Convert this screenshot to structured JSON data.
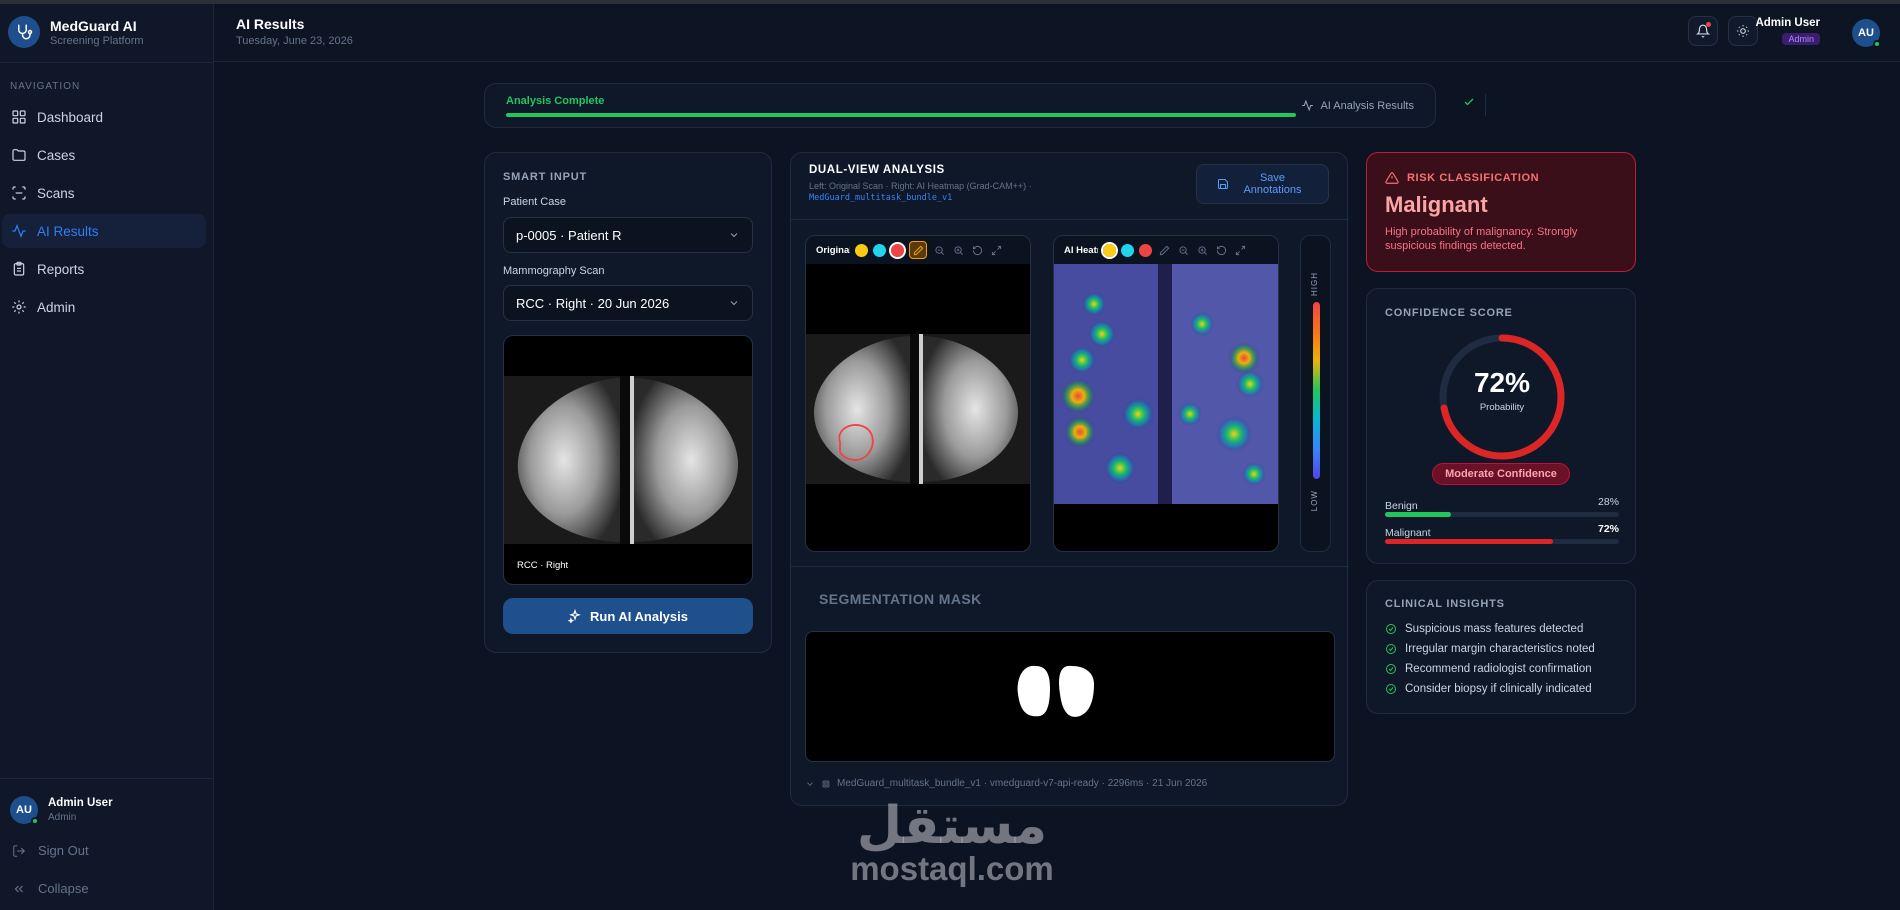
{
  "sidebar": {
    "brand_title": "MedGuard AI",
    "brand_subtitle": "Screening Platform",
    "nav_heading": "NAVIGATION",
    "items": [
      {
        "label": "Dashboard",
        "icon": "grid-icon",
        "active": false
      },
      {
        "label": "Cases",
        "icon": "folder-icon",
        "active": false
      },
      {
        "label": "Scans",
        "icon": "scan-icon",
        "active": false
      },
      {
        "label": "AI Results",
        "icon": "activity-icon",
        "active": true
      },
      {
        "label": "Reports",
        "icon": "clipboard-icon",
        "active": false
      },
      {
        "label": "Admin",
        "icon": "gear-icon",
        "active": false
      }
    ],
    "user_initials": "AU",
    "user_name": "Admin User",
    "user_role": "Admin",
    "sign_out": "Sign Out",
    "collapse": "Collapse"
  },
  "header": {
    "title": "AI Results",
    "date": "Tuesday, June 23, 2026",
    "user_name": "Admin User",
    "user_badge": "Admin",
    "user_initials": "AU"
  },
  "progress": {
    "label": "Analysis Complete",
    "percent": 100,
    "right_label": "AI Analysis Results"
  },
  "smart_input": {
    "title": "SMART INPUT",
    "patient_label": "Patient Case",
    "patient_value": "p-0005 · Patient R",
    "scan_label": "Mammography Scan",
    "scan_value": "RCC · Right · 20 Jun 2026",
    "thumb_caption": "RCC · Right",
    "run_button": "Run AI Analysis"
  },
  "dual_view": {
    "title": "DUAL-VIEW ANALYSIS",
    "subtitle": "Left: Original Scan · Right: AI Heatmap (Grad-CAM++) ·",
    "model": "MedGuard_multitask_bundle_v1",
    "save_button": "Save Annotations",
    "left_viewer_title": "Original",
    "right_viewer_title": "AI Heatmap",
    "legend_high": "HIGH",
    "legend_low": "LOW",
    "swatch_colors": [
      "#facc15",
      "#22d3ee",
      "#ef4444"
    ],
    "segmentation_title": "SEGMENTATION MASK",
    "footer": "MedGuard_multitask_bundle_v1 · vmedguard-v7-api-ready · 2296ms · 21 Jun 2026"
  },
  "risk": {
    "label": "RISK CLASSIFICATION",
    "value": "Malignant",
    "description": "High probability of malignancy. Strongly suspicious findings detected."
  },
  "confidence": {
    "title": "CONFIDENCE SCORE",
    "value": "72%",
    "percent": 72,
    "sublabel": "Probability",
    "badge": "Moderate Confidence",
    "benign_label": "Benign",
    "benign_value": "28%",
    "benign_percent": 28,
    "malignant_label": "Malignant",
    "malignant_value": "72%",
    "malignant_percent": 72,
    "colors": {
      "benign": "#22c55e",
      "malignant": "#dc2626",
      "accent": "#dc2626"
    }
  },
  "insights": {
    "title": "CLINICAL INSIGHTS",
    "items": [
      "Suspicious mass features detected",
      "Irregular margin characteristics noted",
      "Recommend radiologist confirmation",
      "Consider biopsy if clinically indicated"
    ]
  },
  "watermark": {
    "arabic": "مستقل",
    "latin": "mostaql.com"
  }
}
